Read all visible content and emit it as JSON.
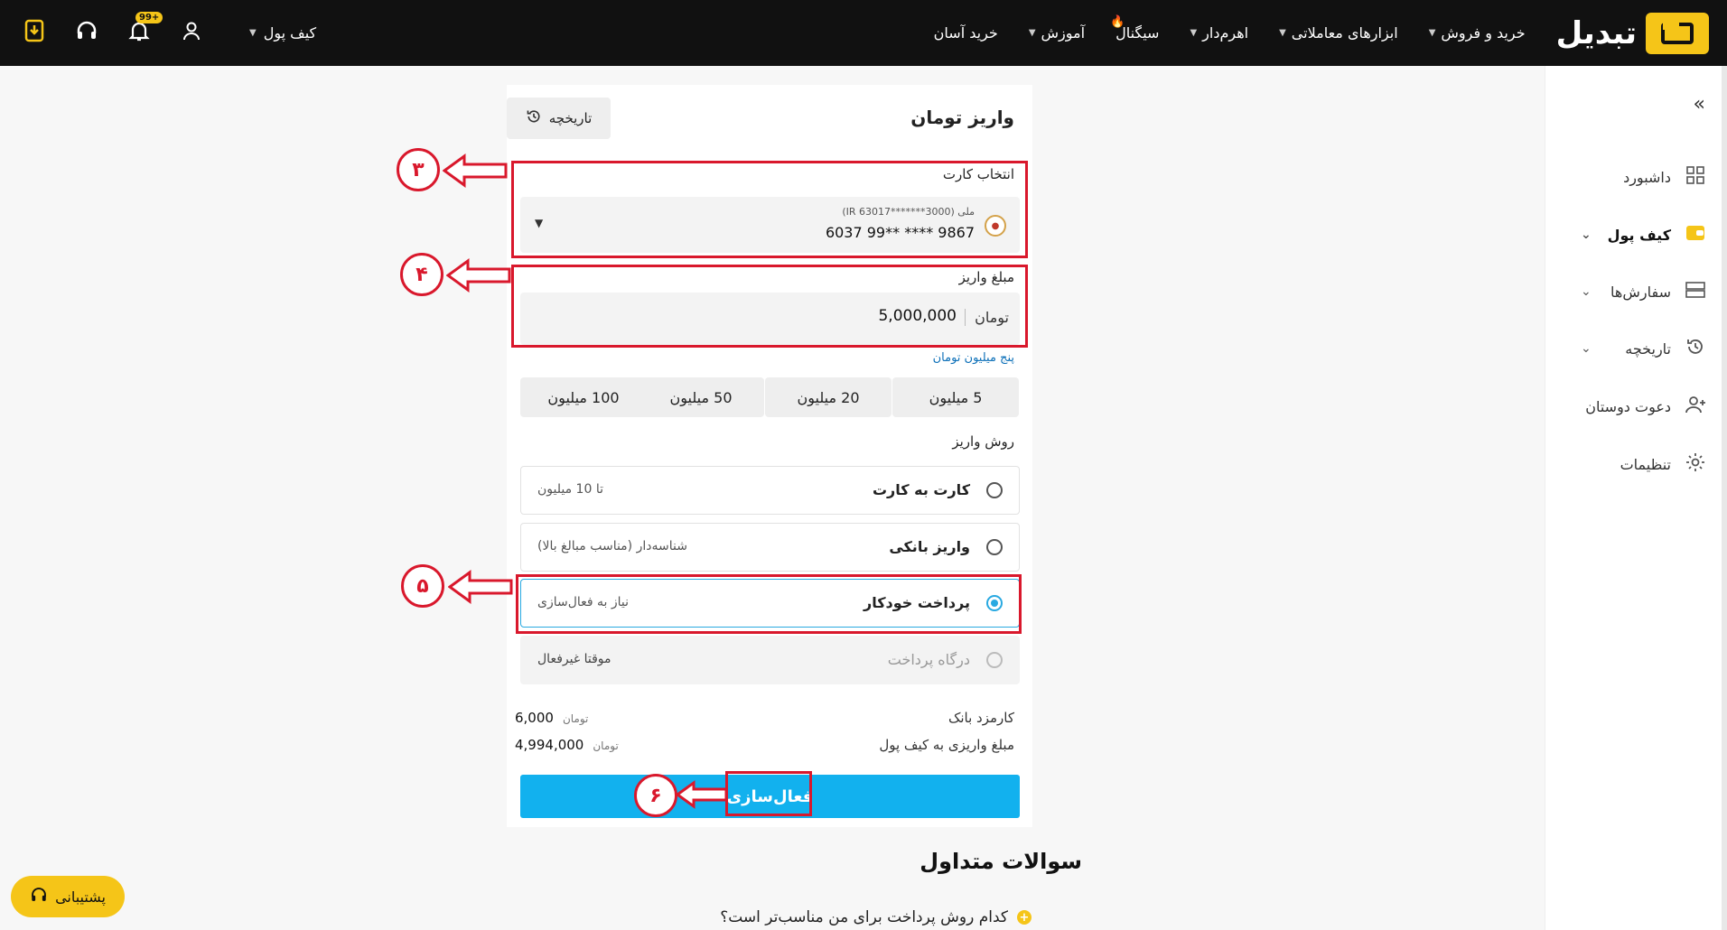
{
  "brand": {
    "name": "تبدیل"
  },
  "nav": {
    "items": [
      {
        "label": "خرید و فروش",
        "has_caret": true
      },
      {
        "label": "ابزارهای معاملاتی",
        "has_caret": true
      },
      {
        "label": "اهرم‌دار",
        "has_caret": true
      },
      {
        "label": "سیگنال",
        "has_caret": false
      },
      {
        "label": "آموزش",
        "has_caret": true
      },
      {
        "label": "خرید آسان",
        "has_caret": false
      }
    ],
    "wallet_menu": "کیف پول",
    "notification_badge": "99+"
  },
  "sidebar": {
    "items": [
      {
        "label": "داشبورد",
        "icon": "dashboard-icon"
      },
      {
        "label": "کیف پول",
        "icon": "wallet-icon",
        "active": true,
        "expandable": true
      },
      {
        "label": "سفارش‌ها",
        "icon": "orders-icon",
        "expandable": true
      },
      {
        "label": "تاریخچه",
        "icon": "history-icon",
        "expandable": true
      },
      {
        "label": "دعوت دوستان",
        "icon": "invite-icon"
      },
      {
        "label": "تنظیمات",
        "icon": "gear-icon"
      }
    ]
  },
  "page": {
    "title": "واریز تومان",
    "history_button": "تاریخچه"
  },
  "card": {
    "label": "انتخاب کارت",
    "bank_meta": "ملی (IR 63017*******3000)",
    "number": "6037 99** **** 9867"
  },
  "amount": {
    "label": "مبلغ واریز",
    "value": "5,000,000",
    "unit": "تومان",
    "in_words": "پنج میلیون تومان"
  },
  "presets": [
    "5 میلیون",
    "20 میلیون",
    "50 میلیون",
    "100 میلیون"
  ],
  "methods": {
    "label": "روش واریز",
    "items": [
      {
        "name": "کارت به کارت",
        "note": "تا 10 میلیون",
        "state": "default"
      },
      {
        "name": "واریز بانکی",
        "note": "شناسه‌دار (مناسب مبالغ بالا)",
        "state": "default"
      },
      {
        "name": "پرداخت خودکار",
        "note": "نیاز به فعال‌سازی",
        "state": "selected"
      },
      {
        "name": "درگاه پرداخت",
        "note": "موقتا غیرفعال",
        "state": "disabled"
      }
    ]
  },
  "summary": {
    "bank_fee_label": "کارمزد بانک",
    "bank_fee_value": "6,000",
    "deposit_label": "مبلغ واریزی به کیف پول",
    "deposit_value": "4,994,000",
    "unit": "تومان"
  },
  "activate_button": "فعال‌سازی",
  "faq": {
    "title": "سوالات متداول",
    "first_question": "کدام روش پرداخت برای من مناسب‌تر است؟"
  },
  "support_button": "پشتیبانی",
  "annotations": {
    "step3": "۳",
    "step4": "۴",
    "step5": "۵",
    "step6": "۶",
    "color": "#d9182c"
  },
  "colors": {
    "topbar": "#111111",
    "brand_yellow": "#f5c518",
    "primary_blue": "#12b1ee"
  }
}
